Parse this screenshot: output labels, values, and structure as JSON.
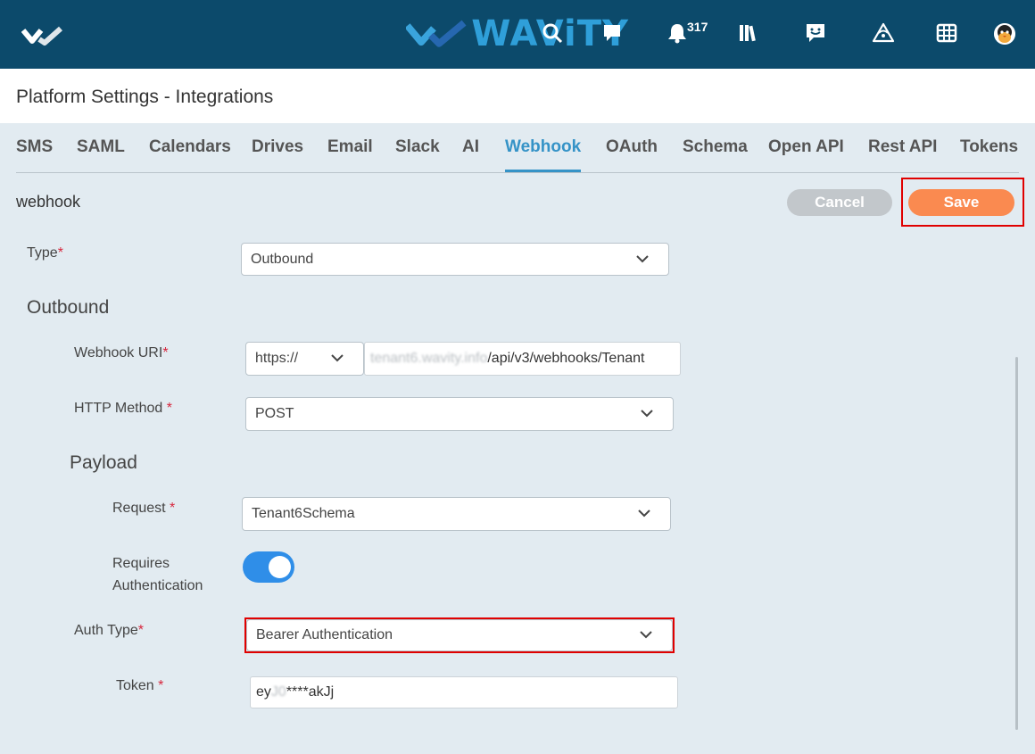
{
  "brand": {
    "name": "WAViTY",
    "accent": "#2f9fd9",
    "bar_color": "#0c4a6b"
  },
  "topbar": {
    "icons": [
      "search-icon",
      "chat-icon",
      "bell-icon",
      "library-icon",
      "feedback-icon",
      "signal-icon",
      "grid-icon",
      "avatar"
    ],
    "notifications_count": "317"
  },
  "header": {
    "title": "Platform Settings - Integrations"
  },
  "tabs": [
    {
      "label": "SMS"
    },
    {
      "label": "SAML"
    },
    {
      "label": "Calendars"
    },
    {
      "label": "Drives"
    },
    {
      "label": "Email"
    },
    {
      "label": "Slack"
    },
    {
      "label": "AI"
    },
    {
      "label": "Webhook",
      "active": true
    },
    {
      "label": "OAuth"
    },
    {
      "label": "Schema"
    },
    {
      "label": "Open API"
    },
    {
      "label": "Rest API"
    },
    {
      "label": "Tokens"
    }
  ],
  "section": {
    "label": "webhook",
    "cancel_label": "Cancel",
    "save_label": "Save"
  },
  "form": {
    "type": {
      "label": "Type",
      "value": "Outbound"
    },
    "outbound_heading": "Outbound",
    "webhook_uri": {
      "label": "Webhook URI",
      "protocol": "https://",
      "value_blurred": "tenant6.wavity.info",
      "value_rest": "/api/v3/webhooks/Tenant"
    },
    "http_method": {
      "label": "HTTP Method",
      "value": "POST"
    },
    "payload_heading": "Payload",
    "request": {
      "label": "Request",
      "value": "Tenant6Schema"
    },
    "requires_auth": {
      "label_line1": "Requires",
      "label_line2": "Authentication",
      "enabled": true
    },
    "auth_type": {
      "label": "Auth Type",
      "value": "Bearer Authentication"
    },
    "token": {
      "label": "Token",
      "value_start": "ey",
      "value_blurred": "J0",
      "value_rest": "****akJj"
    }
  },
  "required_marker": "*"
}
